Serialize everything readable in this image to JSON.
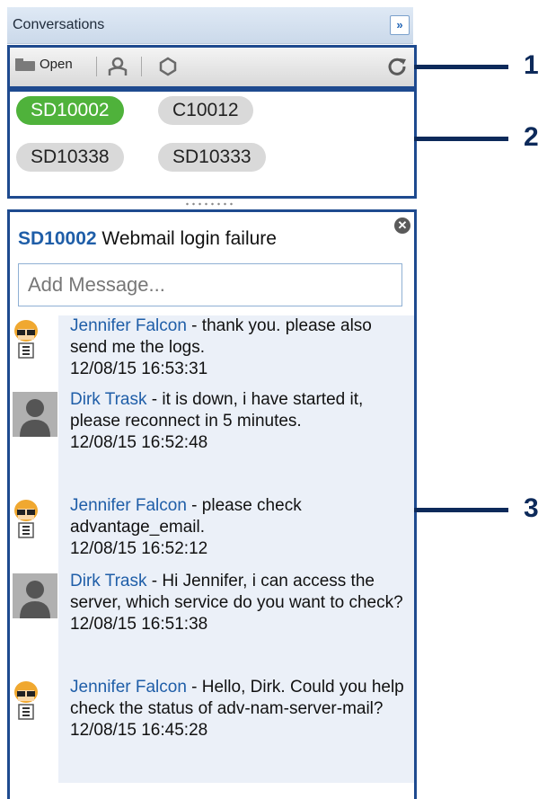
{
  "header": {
    "title": "Conversations",
    "collapse_icon": "»"
  },
  "toolbar": {
    "open_label": "Open"
  },
  "tabs": [
    {
      "label": "SD10002",
      "active": true
    },
    {
      "label": "C10012",
      "active": false
    },
    {
      "label": "SD10338",
      "active": false
    },
    {
      "label": "SD10333",
      "active": false
    }
  ],
  "conversation": {
    "ticket_id": "SD10002",
    "ticket_title": "Webmail login failure",
    "add_message_placeholder": "Add Message...",
    "messages": [
      {
        "author": "Jennifer Falcon",
        "avatar": "female-avatar-icon",
        "text_line1": " - thank you. please",
        "text_rest": "also send me the logs.",
        "time": "12/08/15 16:53:31"
      },
      {
        "author": "Dirk Trask",
        "avatar": "default-user-icon",
        "text_line1": " - it is down, i have",
        "text_rest": "started it, please reconnect in 5 minutes.",
        "time": "12/08/15 16:52:48"
      },
      {
        "author": "Jennifer Falcon",
        "avatar": "female-avatar-icon",
        "text_line1": " - please check",
        "text_rest": "advantage_email.",
        "time": "12/08/15 16:52:12"
      },
      {
        "author": "Dirk Trask",
        "avatar": "default-user-icon",
        "text_line1": " - Hi Jennifer, i can",
        "text_rest": "access the server, which service do you want to check?",
        "time": "12/08/15 16:51:38"
      },
      {
        "author": "Jennifer Falcon",
        "avatar": "female-avatar-icon",
        "text_line1": " - Hello, Dirk. Could",
        "text_rest": "you help check the status of adv-nam-server-mail?",
        "time": "12/08/15 16:45:28"
      }
    ]
  },
  "callouts": [
    "1",
    "2",
    "3"
  ],
  "colors": {
    "accent_blue": "#1e4a8f",
    "active_tab": "#4fb23b",
    "author_blue": "#1f5ea8",
    "message_bg": "#ebf0f8"
  }
}
